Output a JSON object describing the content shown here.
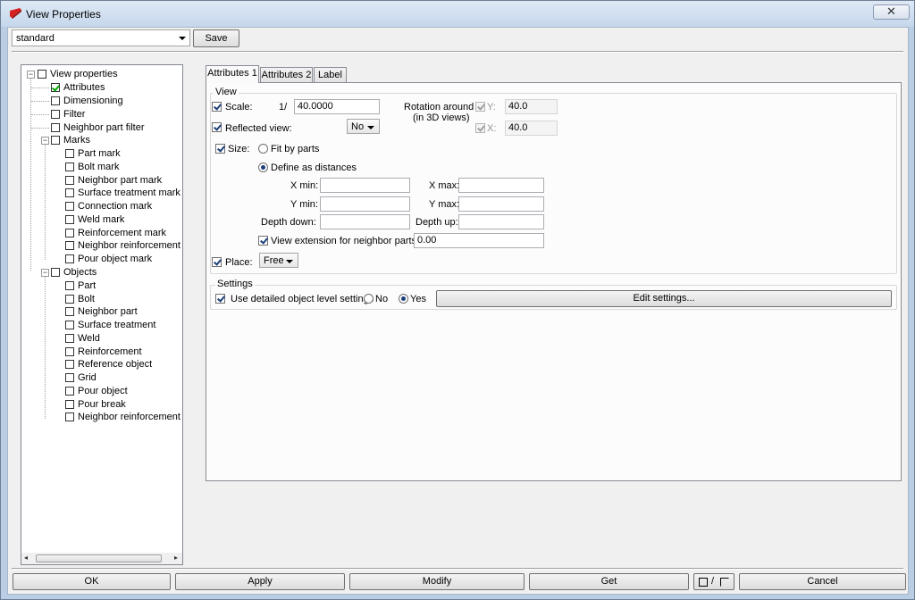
{
  "window": {
    "title": "View Properties",
    "close_glyph": "✕"
  },
  "toolbar": {
    "settings_value": "standard",
    "save_label": "Save"
  },
  "tree": {
    "root": "View properties",
    "items": [
      {
        "label": "Attributes",
        "checked": true
      },
      {
        "label": "Dimensioning"
      },
      {
        "label": "Filter"
      },
      {
        "label": "Neighbor part filter"
      }
    ],
    "marks": {
      "label": "Marks",
      "children": [
        "Part mark",
        "Bolt mark",
        "Neighbor part mark",
        "Surface treatment mark",
        "Connection mark",
        "Weld mark",
        "Reinforcement mark",
        "Neighbor reinforcement ma",
        "Pour object mark"
      ]
    },
    "objects": {
      "label": "Objects",
      "children": [
        "Part",
        "Bolt",
        "Neighbor part",
        "Surface treatment",
        "Weld",
        "Reinforcement",
        "Reference object",
        "Grid",
        "Pour object",
        "Pour break",
        "Neighbor reinforcement"
      ]
    },
    "scroll_left": "◂",
    "scroll_right": "▸"
  },
  "tabs": [
    "Attributes 1",
    "Attributes 2",
    "Label"
  ],
  "view_group": {
    "title": "View",
    "scale_label": "Scale:",
    "scale_prefix": "1/",
    "scale_value": "40.0000",
    "rotation_label_1": "Rotation around",
    "rotation_label_2": "(in 3D views)",
    "y_label": "Y:",
    "y_value": "40.0",
    "x_label": "X:",
    "x_value": "40.0",
    "reflected_label": "Reflected view:",
    "reflected_value": "No",
    "size_label": "Size:",
    "fit_by_parts": "Fit by parts",
    "define_as_distances": "Define as distances",
    "xmin_label": "X min:",
    "xmax_label": "X max:",
    "ymin_label": "Y min:",
    "ymax_label": "Y max:",
    "depth_down_label": "Depth down:",
    "depth_up_label": "Depth up:",
    "view_extension_label": "View extension for neighbor parts:",
    "view_extension_value": "0.00",
    "place_label": "Place:",
    "place_value": "Free"
  },
  "settings_group": {
    "title": "Settings",
    "use_detailed_label": "Use detailed object level settings",
    "no_label": "No",
    "yes_label": "Yes",
    "edit_settings_label": "Edit settings..."
  },
  "bottom": {
    "ok": "OK",
    "apply": "Apply",
    "modify": "Modify",
    "get": "Get",
    "toggle_separator": "/",
    "cancel": "Cancel"
  },
  "colors": {
    "window_frame": "#b9cde3",
    "client_bg": "#f0f0f0",
    "tab_panel_bg": "#fcfcfc",
    "check_accent": "#1c3f7a"
  }
}
